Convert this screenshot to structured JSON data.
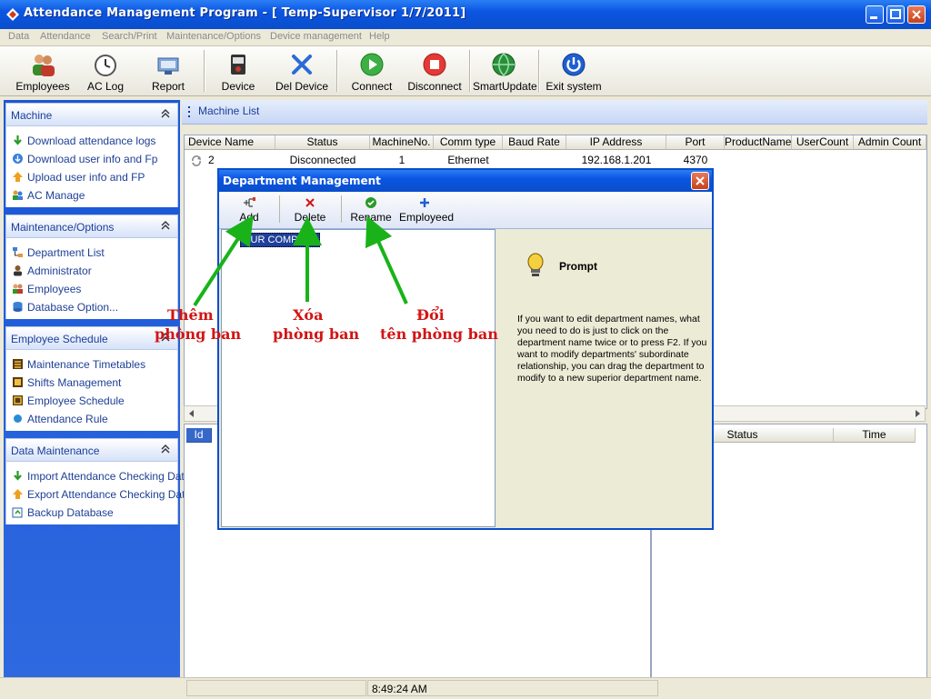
{
  "window": {
    "title": "Attendance Management Program - [ Temp-Supervisor 1/7/2011]"
  },
  "menu": [
    "Data",
    "Attendance",
    "Search/Print",
    "Maintenance/Options",
    "Device management",
    "Help"
  ],
  "toolbar": {
    "employees": "Employees",
    "ac_log": "AC Log",
    "report": "Report",
    "device": "Device",
    "del_device": "Del Device",
    "connect": "Connect",
    "disconnect": "Disconnect",
    "smartupdate": "SmartUpdate",
    "exit": "Exit system"
  },
  "sidebar": {
    "machine": {
      "title": "Machine",
      "items": [
        "Download attendance logs",
        "Download user info and Fp",
        "Upload user info and FP",
        "AC Manage"
      ]
    },
    "maintenance": {
      "title": "Maintenance/Options",
      "items": [
        "Department List",
        "Administrator",
        "Employees",
        "Database Option..."
      ]
    },
    "schedule": {
      "title": "Employee Schedule",
      "items": [
        "Maintenance Timetables",
        "Shifts Management",
        "Employee Schedule",
        "Attendance Rule"
      ]
    },
    "data_maintenance": {
      "title": "Data Maintenance",
      "items": [
        "Import Attendance Checking Data",
        "Export Attendance Checking Data",
        "Backup Database"
      ]
    }
  },
  "machine_list": {
    "title": "Machine List",
    "columns": [
      "Device Name",
      "Status",
      "MachineNo.",
      "Comm type",
      "Baud Rate",
      "IP Address",
      "Port",
      "ProductName",
      "UserCount",
      "Admin Count"
    ],
    "rows": [
      {
        "device_name": "2",
        "status": "Disconnected",
        "machine_no": "1",
        "comm_type": "Ethernet",
        "baud_rate": "",
        "ip": "192.168.1.201",
        "port": "4370"
      }
    ]
  },
  "lower_left": {
    "columns": [
      "Id"
    ]
  },
  "lower_right": {
    "columns": [
      "Status",
      "Time"
    ]
  },
  "statusbar": {
    "time": "8:49:24 AM"
  },
  "dialog": {
    "title": "Department Management",
    "buttons": {
      "add": "Add",
      "delete": "Delete",
      "rename": "Rename",
      "employeed": "Employeed"
    },
    "tree_root": "OUR COMPANY",
    "prompt_title": "Prompt",
    "prompt_text": "If you want to edit department names, what you need to do is just to click on the department name twice or to press F2. If you want to modify departments' subordinate relationship, you can drag the department to modify to a new superior department name."
  },
  "annotations": {
    "add_line1": "Thêm",
    "add_line2": "phòng ban",
    "delete_line1": "Xóa",
    "delete_line2": "phòng ban",
    "rename_line1": "Đổi",
    "rename_line2": "tên phòng ban"
  },
  "colors": {
    "xp_blue": "#0b55e2",
    "annotation_red": "#d21414",
    "arrow_green": "#19b319"
  }
}
